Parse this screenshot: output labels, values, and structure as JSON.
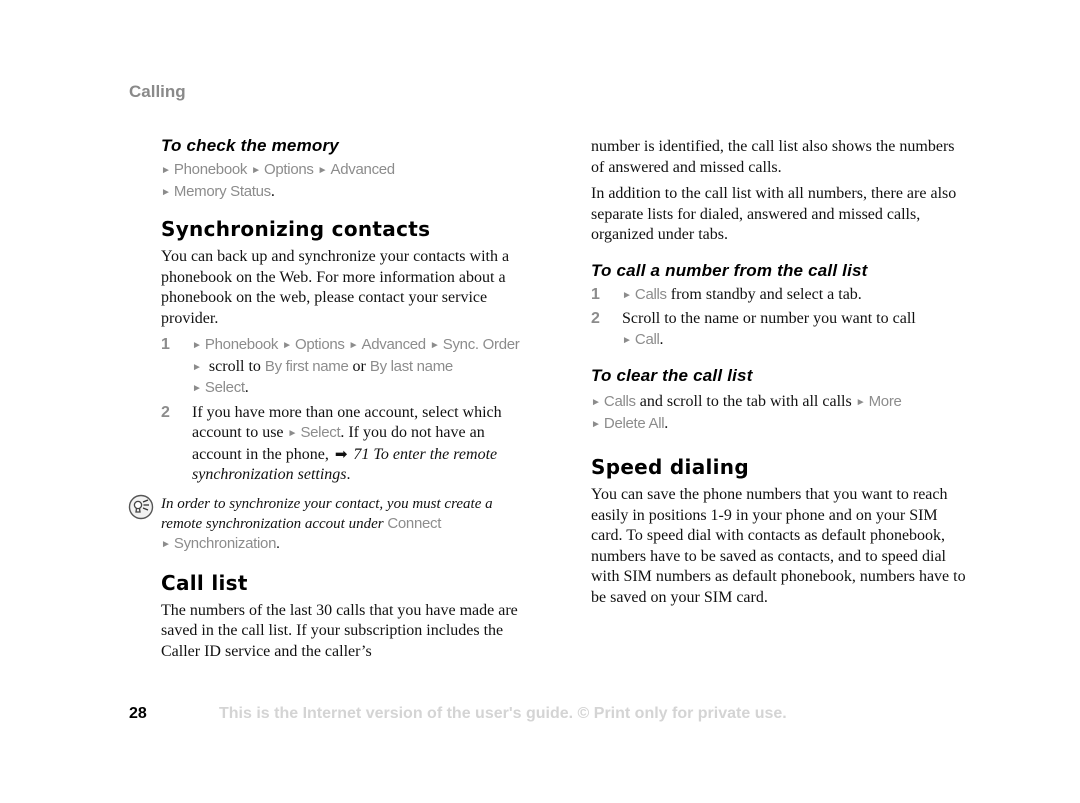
{
  "page": {
    "section_tag": "Calling",
    "page_number": "28",
    "footer_notice": "This is the Internet version of the user's guide. © Print only for private use."
  },
  "left": {
    "check_memory": {
      "title": "To check the memory",
      "nav1": [
        "Phonebook",
        "Options",
        "Advanced"
      ],
      "nav2": "Memory Status",
      "nav2_suffix": "."
    },
    "sync": {
      "heading": "Synchronizing contacts",
      "intro": "You can back up and synchronize your contacts with a phonebook on the Web. For more information about a phonebook on the web, please contact your service provider.",
      "step1": {
        "num": "1",
        "menu_a": "Phonebook",
        "menu_b": "Options",
        "menu_c": "Advanced",
        "menu_d": "Sync. Order",
        "text_scroll": " scroll to ",
        "opt1": "By first name",
        "text_or": " or ",
        "opt2": "By last name",
        "menu_e": "Select",
        "suffix": "."
      },
      "step2": {
        "num": "2",
        "text_a": "If you have more than one account, select which account to use ",
        "menu_select": "Select",
        "text_b": ". If you do not have an account in the phone, ",
        "ref_arrow": "➡",
        "ref_text": " 71 To enter the remote synchronization settings",
        "suffix": "."
      },
      "note": {
        "icon": "tip-lightbulb-icon",
        "text": "In order to synchronize your contact, you must create a remote synchronization accout under ",
        "menu_a": "Connect",
        "menu_b": "Synchronization",
        "suffix": "."
      }
    },
    "call_list": {
      "heading": "Call list",
      "text": "The numbers of the last 30 calls that you have made are saved in the call list. If your subscription includes the Caller ID service and the caller’s"
    }
  },
  "right": {
    "continued": "number is identified, the call list also shows the numbers of answered and missed calls.",
    "tabs_para": "In addition to the call list with all numbers, there are also separate lists for dialed, answered and missed calls, organized under tabs.",
    "call_number": {
      "title": "To call a number from the call list",
      "step1": {
        "num": "1",
        "menu": "Calls",
        "text": " from standby and select a tab."
      },
      "step2": {
        "num": "2",
        "text": "Scroll to the name or number you want to call ",
        "menu": "Call",
        "suffix": "."
      }
    },
    "clear_list": {
      "title": "To clear the call list",
      "menu_a": "Calls",
      "text": " and scroll to the tab with all calls ",
      "menu_b": "More",
      "menu_c": "Delete All",
      "suffix": "."
    },
    "speed_dial": {
      "heading": "Speed dialing",
      "text": "You can save the phone numbers that you want to reach easily in positions 1-9 in your phone and on your SIM card. To speed dial with contacts as default phonebook, numbers have to be saved as contacts, and to speed dial with SIM numbers as default phonebook, numbers have to be saved on your SIM card."
    }
  },
  "glyphs": {
    "menu_arrow": "►"
  }
}
